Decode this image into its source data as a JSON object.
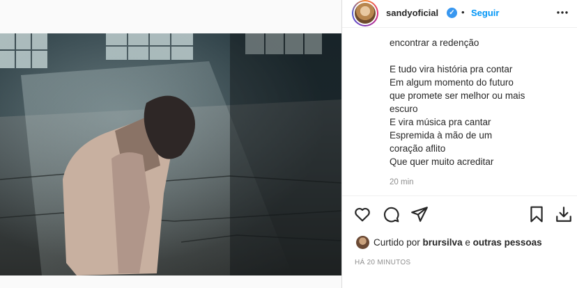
{
  "post": {
    "username": "sandyoficial",
    "verified_mark": "✓",
    "separator": "•",
    "follow_label": "Seguir",
    "caption_lines": [
      "encontrar a redenção",
      "",
      "E tudo vira história pra contar",
      "Em algum momento do futuro",
      "que promete ser melhor ou mais",
      "escuro",
      "E vira música pra cantar",
      "Espremida à mão de um",
      "coração aflito",
      "Que quer muito acreditar"
    ],
    "caption_time": "20 min",
    "likes_prefix": "Curtido por ",
    "likes_user": "brursilva",
    "likes_and": " e ",
    "likes_others": "outras pessoas",
    "posted_time": "HÁ 20 MINUTOS"
  },
  "icons": {
    "more": "more-options-icon",
    "like": "heart-icon",
    "comment": "comment-icon",
    "share": "share-icon",
    "save": "bookmark-icon",
    "download": "download-icon"
  },
  "colors": {
    "link_blue": "#0095f6",
    "verified_blue": "#3897f0",
    "text": "#262626",
    "muted": "#8e8e8e"
  }
}
